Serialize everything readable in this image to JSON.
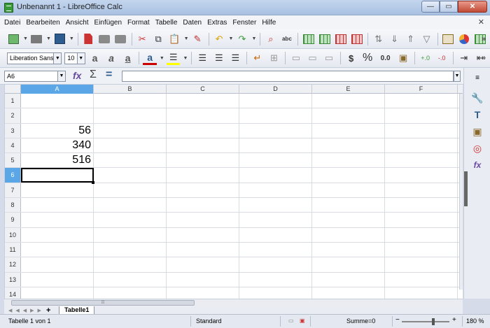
{
  "window": {
    "title": "Unbenannt 1 - LibreOffice Calc",
    "min": "—",
    "max": "▭",
    "close": "✕"
  },
  "menu": [
    "Datei",
    "Bearbeiten",
    "Ansicht",
    "Einfügen",
    "Format",
    "Tabelle",
    "Daten",
    "Extras",
    "Fenster",
    "Hilfe"
  ],
  "formatting": {
    "font_name": "Liberation Sans",
    "font_size": "10",
    "currency": "$",
    "percent": "%",
    "number": "0.0"
  },
  "namebox": {
    "value": "A6"
  },
  "columns": [
    "A",
    "B",
    "C",
    "D",
    "E",
    "F"
  ],
  "rows": [
    {
      "num": "1",
      "a": ""
    },
    {
      "num": "2",
      "a": ""
    },
    {
      "num": "3",
      "a": "56"
    },
    {
      "num": "4",
      "a": "340"
    },
    {
      "num": "5",
      "a": "516"
    },
    {
      "num": "6",
      "a": ""
    },
    {
      "num": "7",
      "a": ""
    },
    {
      "num": "8",
      "a": ""
    },
    {
      "num": "9",
      "a": ""
    },
    {
      "num": "10",
      "a": ""
    },
    {
      "num": "11",
      "a": ""
    },
    {
      "num": "12",
      "a": ""
    },
    {
      "num": "13",
      "a": ""
    },
    {
      "num": "14",
      "a": ""
    }
  ],
  "sheet_tab": "Tabelle1",
  "status": {
    "sheet": "Tabelle 1 von 1",
    "style": "Standard",
    "sum": "Summe=0",
    "zoom": "180 %"
  },
  "icons": {
    "toolbar1": [
      "new-icon",
      "open-icon",
      "save-icon",
      "export-pdf-icon",
      "print-icon",
      "print-preview-icon",
      "cut-icon",
      "copy-icon",
      "paste-icon",
      "clone-format-icon",
      "undo-icon",
      "redo-icon",
      "find-replace-icon",
      "spellcheck-icon",
      "insert-rows-icon",
      "insert-columns-icon",
      "delete-rows-icon",
      "delete-columns-icon",
      "sort-icon",
      "sort-ascending-icon",
      "sort-descending-icon",
      "autofilter-icon",
      "image-icon",
      "chart-icon"
    ],
    "sidebar": [
      "properties-icon",
      "styles-icon",
      "gallery-icon",
      "navigator-icon",
      "functions-icon"
    ]
  }
}
